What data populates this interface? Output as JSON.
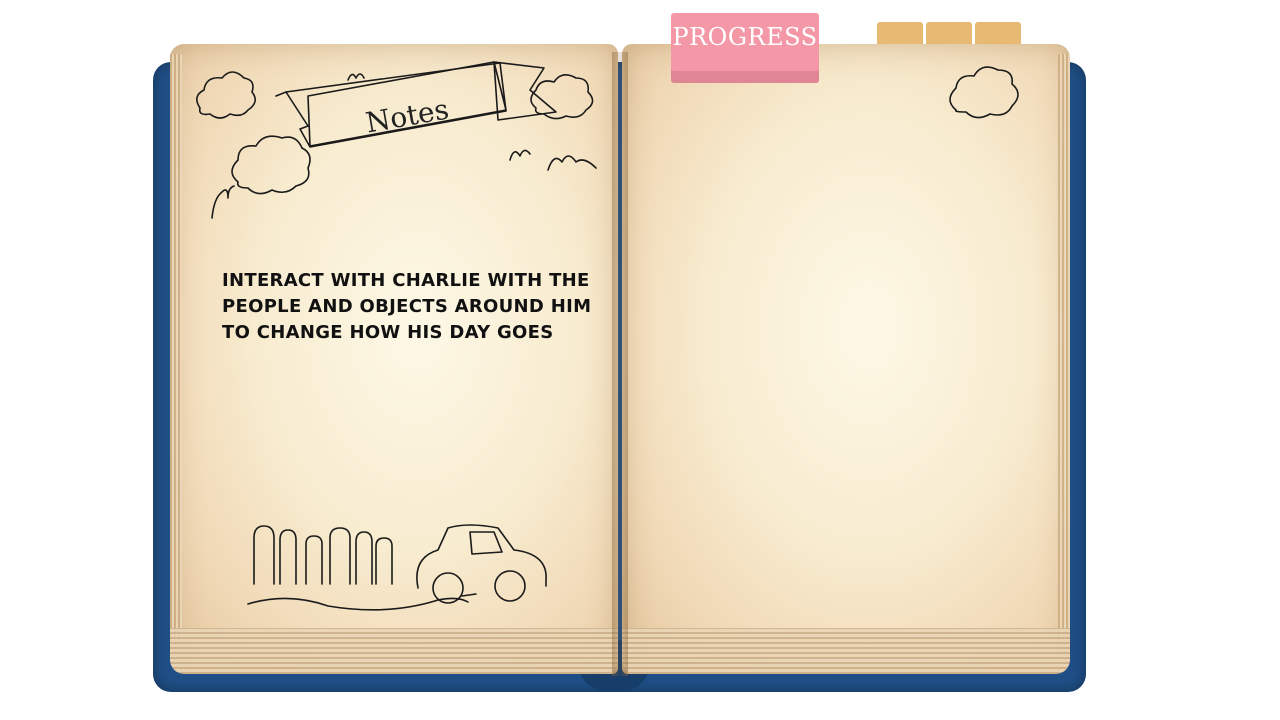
{
  "notebook": {
    "notes_title": "Notes",
    "instruction": "INTERACT WITH CHARLIE WITH THE PEOPLE AND OBJECTS AROUND HIM TO CHANGE HOW HIS DAY GOES"
  },
  "tabs": {
    "progress_label": "PROGRESS",
    "colors": {
      "progress": "#f497a7",
      "section": "#e8b972"
    }
  },
  "book": {
    "cover_color": "#1f4f86",
    "page_color": "#f8ecd0"
  },
  "icons": [
    "cloud-icon",
    "bird-icon",
    "fence-icon",
    "car-icon",
    "ribbon-banner"
  ]
}
